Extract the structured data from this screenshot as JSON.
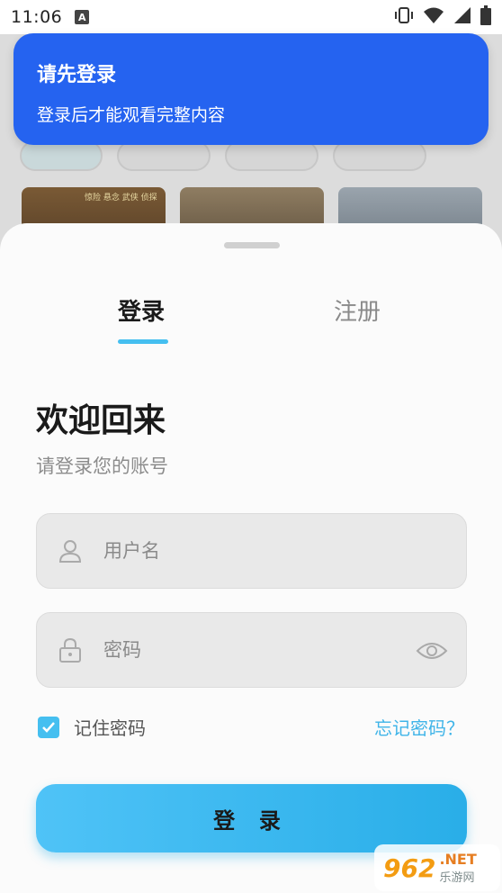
{
  "status_bar": {
    "time": "11:06",
    "notification_letter": "A",
    "icons": [
      "vibrate-icon",
      "wifi-icon",
      "signal-icon",
      "battery-icon"
    ]
  },
  "toast": {
    "title": "请先登录",
    "message": "登录后才能观看完整内容",
    "color": "#2563f0"
  },
  "background": {
    "thumb_tag": "惊险 悬念 武侠 侦探"
  },
  "tabs": {
    "login": "登录",
    "register": "注册",
    "active": "login",
    "accent": "#45bff0"
  },
  "form": {
    "welcome": "欢迎回来",
    "subtitle": "请登录您的账号",
    "username_placeholder": "用户名",
    "password_placeholder": "密码",
    "remember_label": "记住密码",
    "remember_checked": true,
    "forgot_label": "忘记密码？",
    "submit_label": "登 录"
  },
  "watermark": {
    "number": "962",
    "suffix": ".NET",
    "cn": "乐游网"
  }
}
